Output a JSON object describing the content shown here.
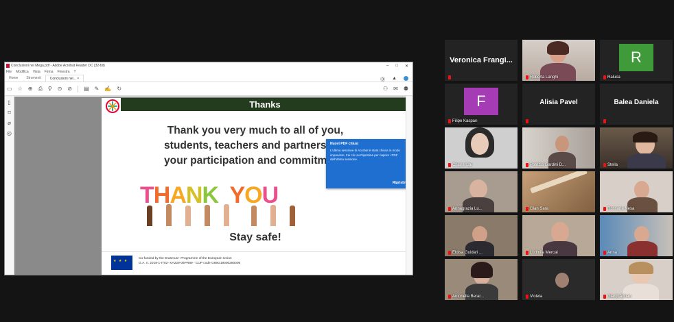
{
  "window": {
    "title": "Conclusioni nel Mega.pdf - Adobe Acrobat Reader DC (32-bit)",
    "controls": [
      "–",
      "□",
      "✕"
    ],
    "menus": [
      "File",
      "Modifica",
      "Vista",
      "Firma",
      "Finestra",
      "?"
    ],
    "tabs": [
      "Home",
      "Strumenti",
      "Conclusioni nel... ×"
    ]
  },
  "slide": {
    "header": "Thanks",
    "message_lines": [
      "Thank you very much to all of you,",
      "students, teachers and partners, for",
      "your participation and commitment!"
    ],
    "image_text": "THANK YOU",
    "stay_safe": "Stay safe!",
    "footer_line1": "Co-funded by the Erasmus+ Programme of the European Union",
    "footer_line2": "G.A. n. 2019-1-IT02- KA229-06PR89 - CUP code G69G19000280006"
  },
  "notification": {
    "title": "Nuovi PDF chiusi",
    "body": "L'ultima sessione di Acrobat è stata chiusa in modo imprevisto. Fai clic su Ripristina per riaprire i PDF dell'ultima sessione.",
    "close": "×",
    "button": "Ripristina"
  },
  "participants": [
    {
      "name": "Veronica Frangi...",
      "type": "name"
    },
    {
      "name": "Roberta Langhi",
      "type": "video"
    },
    {
      "name": "Raluca",
      "type": "avatar",
      "initial": "R",
      "color": "#3f9b39"
    },
    {
      "name": "Filipe Kasparı",
      "type": "avatar",
      "initial": "F",
      "color": "#a53bb5"
    },
    {
      "name": "Alisia Pavel",
      "type": "name"
    },
    {
      "name": "Balea Daniela",
      "type": "name"
    },
    {
      "name": "Chiara Gai",
      "type": "video"
    },
    {
      "name": "Patrizia Gardini D...",
      "type": "video"
    },
    {
      "name": "Stella",
      "type": "video",
      "speaking": true
    },
    {
      "name": "Annagrazia Lu...",
      "type": "video"
    },
    {
      "name": "Gian Sara",
      "type": "video"
    },
    {
      "name": "Rossana Nesa",
      "type": "video"
    },
    {
      "name": "Eloisa Guidari ...",
      "type": "video"
    },
    {
      "name": "Ludmila Mercai",
      "type": "video"
    },
    {
      "name": "Anna",
      "type": "video"
    },
    {
      "name": "Antonella Berar...",
      "type": "video"
    },
    {
      "name": "Violeta",
      "type": "video"
    },
    {
      "name": "Giardi Adrian",
      "type": "video"
    }
  ]
}
